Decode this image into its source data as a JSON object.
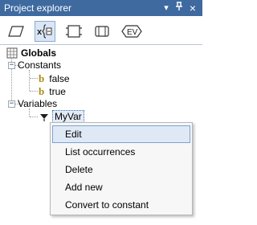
{
  "window": {
    "title": "Project explorer",
    "pin_icon": "pin-icon",
    "close_glyph": "×",
    "dropdown_glyph": "▾"
  },
  "toolbar": {
    "tools": [
      {
        "name": "frames-tool",
        "icon": "parallelogram-icon",
        "active": false
      },
      {
        "name": "variables-tool",
        "icon": "variable-x-icon",
        "active": true
      },
      {
        "name": "objects-tool",
        "icon": "box-icon",
        "active": false
      },
      {
        "name": "components-tool",
        "icon": "cylinder-icon",
        "active": false
      },
      {
        "name": "events-tool",
        "icon": "ev-icon",
        "active": false
      }
    ],
    "ev_label": "EV"
  },
  "tree": {
    "root": "Globals",
    "constants_label": "Constants",
    "constants": [
      "false",
      "true"
    ],
    "variables_label": "Variables",
    "selected_variable": "MyVar",
    "bool_glyph": "b",
    "expand_minus": "−",
    "expand_plus": "+"
  },
  "context_menu": {
    "items": [
      "Edit",
      "List occurrences",
      "Delete",
      "Add new",
      "Convert to constant"
    ],
    "hovered_index": 0
  },
  "colors": {
    "titlebar": "#3e6aa0",
    "selection": "#e4ecf7",
    "menu_hover": "#dfe9f6"
  }
}
